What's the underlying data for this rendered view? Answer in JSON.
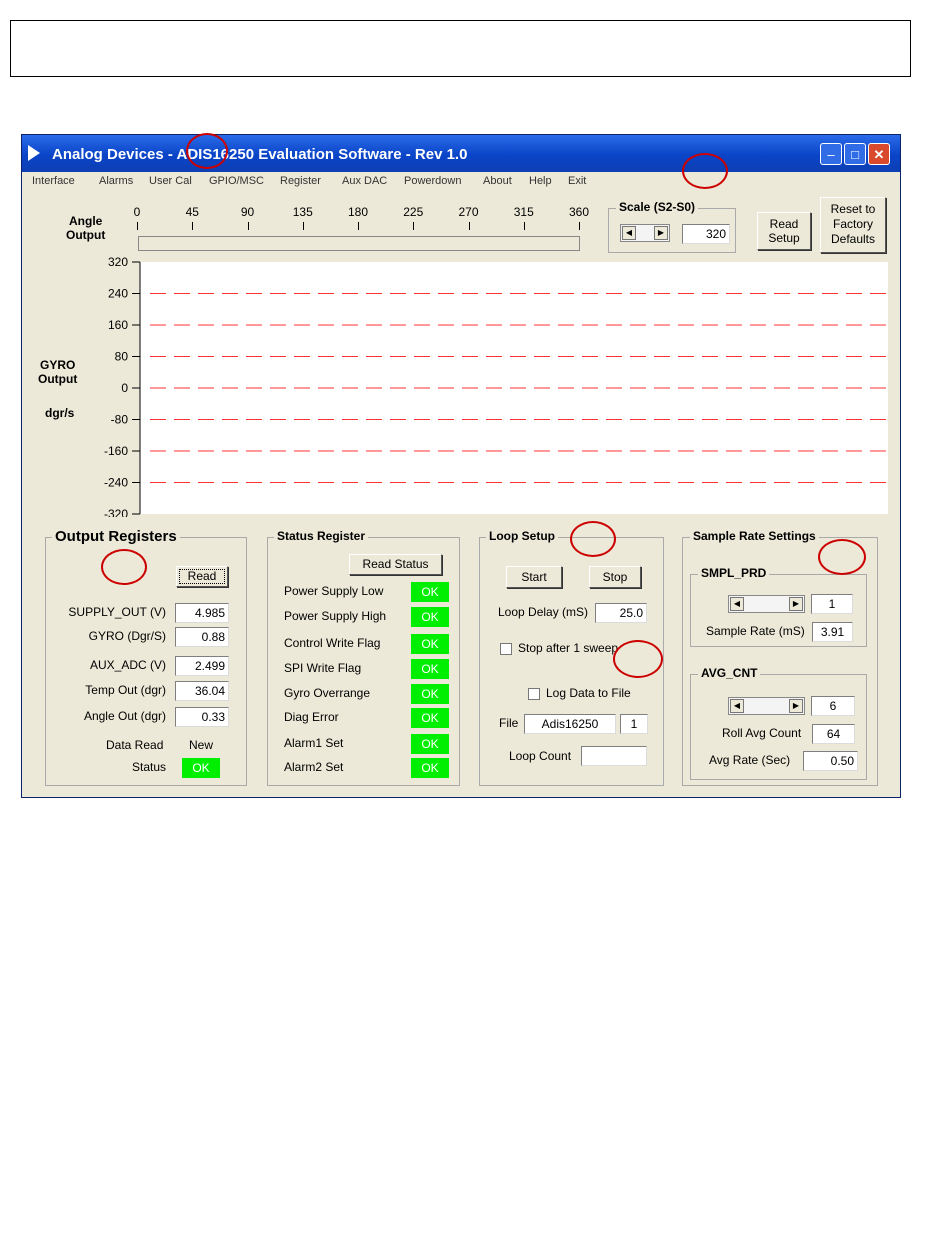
{
  "app": {
    "title": "Analog Devices - ADIS16250 Evaluation Software - Rev 1.0",
    "controls": {
      "minimize": "–",
      "maximize": "□",
      "close": "✕"
    }
  },
  "menu": [
    "Interface",
    "Alarms",
    "User Cal",
    "GPIO/MSC",
    "Register",
    "Aux DAC",
    "Powerdown",
    "About",
    "Help",
    "Exit"
  ],
  "angle": {
    "label1": "Angle",
    "label2": "Output",
    "ticks": [
      "0",
      "45",
      "90",
      "135",
      "180",
      "225",
      "270",
      "315",
      "360"
    ]
  },
  "scale": {
    "title": "Scale  (S2-S0)",
    "value": "320"
  },
  "buttons": {
    "read_setup_1": "Read",
    "read_setup_2": "Setup",
    "reset_1": "Reset to",
    "reset_2": "Factory",
    "reset_3": "Defaults"
  },
  "chart_data": {
    "type": "line",
    "yticks": [
      "320",
      "240",
      "160",
      "80",
      "0",
      "-80",
      "-160",
      "-240",
      "-320"
    ],
    "ylim": [
      -320,
      320
    ],
    "gridlines": [
      240,
      160,
      80,
      0,
      -80,
      -160,
      -240
    ],
    "ylabel": [
      "GYRO",
      "Output",
      "dgr/s"
    ],
    "grid_color": "#ff3333"
  },
  "output_registers": {
    "title": "Output  Registers",
    "read_button": "Read",
    "fields": [
      {
        "label": "SUPPLY_OUT (V)",
        "value": "4.985"
      },
      {
        "label": "GYRO (Dgr/S)",
        "value": "0.88"
      },
      {
        "label": "AUX_ADC (V)",
        "value": "2.499"
      },
      {
        "label": "Temp Out (dgr)",
        "value": "36.04"
      },
      {
        "label": "Angle Out (dgr)",
        "value": "0.33"
      }
    ],
    "data_read_label": "Data Read",
    "data_read_value": "New",
    "status_label": "Status",
    "status_value": "OK"
  },
  "status_register": {
    "title": "Status Register",
    "read_button": "Read Status",
    "flags": [
      {
        "label": "Power Supply Low",
        "value": "OK"
      },
      {
        "label": "Power Supply High",
        "value": "OK"
      },
      {
        "label": "Control Write Flag",
        "value": "OK"
      },
      {
        "label": "SPI Write Flag",
        "value": "OK"
      },
      {
        "label": "Gyro Overrange",
        "value": "OK"
      },
      {
        "label": "Diag Error",
        "value": "OK"
      },
      {
        "label": "Alarm1 Set",
        "value": "OK"
      },
      {
        "label": "Alarm2 Set",
        "value": "OK"
      }
    ]
  },
  "loop_setup": {
    "title": "Loop Setup",
    "start": "Start",
    "stop": "Stop",
    "loop_delay_label": "Loop Delay (mS)",
    "loop_delay_value": "25.0",
    "stop_after_label": "Stop after 1 sweep",
    "log_label": "Log Data to File",
    "file_label": "File",
    "file_value": "Adis16250",
    "file_index": "1",
    "loop_count_label": "Loop Count",
    "loop_count_value": ""
  },
  "sample_rate": {
    "title": "Sample Rate Settings",
    "smpl_title": "SMPL_PRD",
    "smpl_value": "1",
    "sample_rate_label": "Sample Rate (mS)",
    "sample_rate_value": "3.91",
    "avg_title": "AVG_CNT",
    "avg_value": "6",
    "roll_label": "Roll Avg Count",
    "roll_value": "64",
    "avg_rate_label": "Avg Rate (Sec)",
    "avg_rate_value": "0.50"
  }
}
